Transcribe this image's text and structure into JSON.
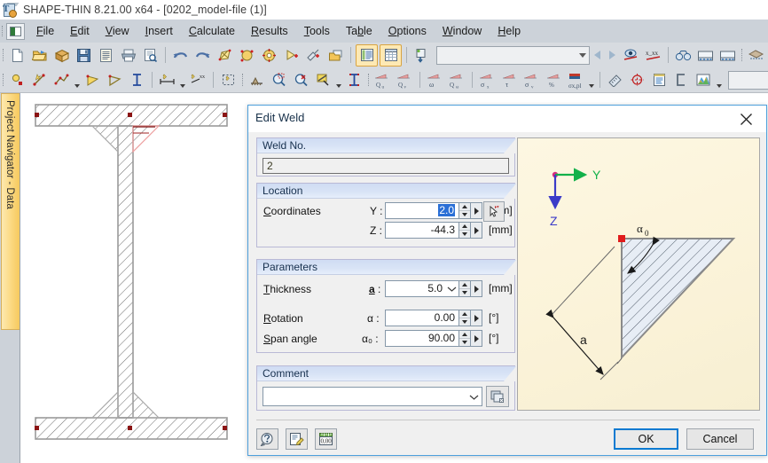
{
  "window": {
    "title": "SHAPE-THIN 8.21.00 x64 - [0202_model-file (1)]",
    "icon": "app-icon"
  },
  "menu": {
    "items": [
      {
        "label": "File",
        "accel": "F"
      },
      {
        "label": "Edit",
        "accel": "E"
      },
      {
        "label": "View",
        "accel": "V"
      },
      {
        "label": "Insert",
        "accel": "I"
      },
      {
        "label": "Calculate",
        "accel": "C"
      },
      {
        "label": "Results",
        "accel": "R"
      },
      {
        "label": "Tools",
        "accel": "T"
      },
      {
        "label": "Table",
        "accel": "b"
      },
      {
        "label": "Options",
        "accel": "O"
      },
      {
        "label": "Window",
        "accel": "W"
      },
      {
        "label": "Help",
        "accel": "H"
      }
    ]
  },
  "toolbar_row1": {
    "icons": [
      "new-file-icon",
      "open-folder-icon",
      "open-package-icon",
      "save-icon",
      "save-all-icon",
      "print-icon",
      "print-preview-icon",
      "undo-icon",
      "redo-icon",
      "edit-section-icon",
      "select-node-icon",
      "select-element-icon",
      "add-node-icon",
      "new-window-icon",
      "folder-yellow-icon",
      "show-list-icon",
      "show-table-icon",
      "import-icon"
    ],
    "combo_value": "",
    "icons_right": [
      "prev-icon",
      "next-icon",
      "view-icon",
      "x-xx-icon",
      "binoculars-icon",
      "render-front-icon",
      "render-back-icon",
      "snap-grid-icon",
      "object-snap-icon",
      "rotate-icon",
      "mirror-icon",
      "mirror-axis-icon",
      "warning-icon"
    ]
  },
  "toolbar_row2": {
    "icons": [
      "new-node-icon",
      "new-line-icon",
      "new-polyline-icon",
      "new-element-icon",
      "new-element2-icon",
      "new-profile-icon",
      "dimension-icon",
      "dimension-xx-icon",
      "selection-box-icon",
      "nodal-support-icon",
      "zoom-window-icon",
      "zoom-reset-icon",
      "fill-icon",
      "column-icon"
    ],
    "result_labels": [
      "Qu",
      "Qv",
      "ω",
      "Qω",
      "σx",
      "τ",
      "σv",
      "%",
      "σx,pl"
    ],
    "icons_right": [
      "ruler-icon",
      "center-icon",
      "printout-report-icon",
      "crop-icon",
      "color-palette-icon"
    ],
    "combo_value": ""
  },
  "sidebar": {
    "tab_label": "Project Navigator - Data"
  },
  "canvas": {
    "name": "cross-section-view"
  },
  "dialog": {
    "title": "Edit Weld",
    "close_label": "×",
    "weld_no": {
      "section_label": "Weld No.",
      "value": "2"
    },
    "location": {
      "section_label": "Location",
      "row_label": "Coordinates",
      "row_label_accel": "C",
      "y": {
        "symbol": "Y :",
        "value": "2.0",
        "unit": "[mm]"
      },
      "z": {
        "symbol": "Z :",
        "value": "-44.3",
        "unit": "[mm]"
      },
      "pick_icon": "pick-point-icon"
    },
    "parameters": {
      "section_label": "Parameters",
      "rows": [
        {
          "label": "Thickness",
          "accel": "T",
          "symbol": "a :",
          "value": "5.0",
          "unit": "[mm]",
          "dropdown": true
        },
        {
          "label": "Rotation",
          "accel": "R",
          "symbol": "α :",
          "value": "0.00",
          "unit": "[°]",
          "dropdown": false
        },
        {
          "label": "Span angle",
          "accel": "S",
          "symbol": "α₀ :",
          "value": "90.00",
          "unit": "[°]",
          "dropdown": false
        }
      ]
    },
    "comment": {
      "section_label": "Comment",
      "value": "",
      "button_icon": "comment-library-icon"
    },
    "preview": {
      "axis_y_label": "Y",
      "axis_z_label": "Z",
      "angle_label": "α0",
      "thickness_label": "a",
      "axis_y_color": "#12b14a",
      "axis_z_color": "#3b3bc8",
      "origin_color": "#d62c7f",
      "weld_point_color": "#e01b1b",
      "fill_color": "#e7edf5"
    },
    "footer": {
      "help_icon": "help-icon",
      "notes_icon": "notes-icon",
      "units_icon": "units-icon",
      "ok_label": "OK",
      "cancel_label": "Cancel"
    }
  },
  "colors": {
    "dialog_border": "#4ea0dc",
    "section_header": "#d5e0f3",
    "default_button_border": "#0a7ad1",
    "selection_blue": "#2a6fd6",
    "toolbar_bg": "#d7dbe0",
    "menubar_bg": "#ccd2d9",
    "navigator_tab": "#fbd87f"
  }
}
